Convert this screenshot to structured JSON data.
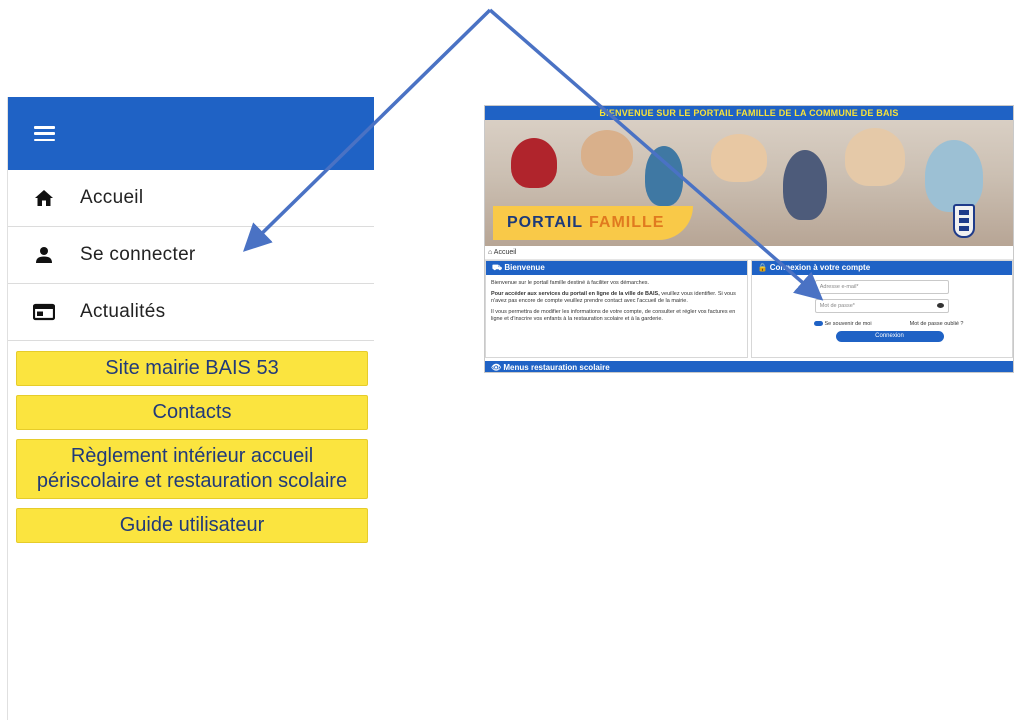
{
  "menu": {
    "items": [
      {
        "label": "Accueil",
        "icon": "home-icon"
      },
      {
        "label": "Se connecter",
        "icon": "person-icon"
      },
      {
        "label": "Actualités",
        "icon": "news-icon"
      }
    ],
    "links": [
      "Site mairie BAIS 53",
      "Contacts",
      "Règlement intérieur accueil périscolaire et restauration scolaire",
      "Guide utilisateur"
    ]
  },
  "portal": {
    "top_banner": "BIENVENUE SUR LE PORTAIL FAMILLE DE LA COMMUNE DE BAIS",
    "hero_word1": "PORTAIL",
    "hero_word2": "FAMILLE",
    "breadcrumb": "Accueil",
    "welcome": {
      "title": "Bienvenue",
      "p1": "Bienvenue sur le portail famille destiné à faciliter vos démarches.",
      "p2_bold": "Pour accéder aux services du portail en ligne de la ville de BAIS,",
      "p2_rest": "veuillez vous identifier. Si vous n'avez pas encore de compte veuillez prendre contact avec l'accueil de la mairie.",
      "p3": "Il vous permettra de modifier les informations de votre compte, de consulter et régler vos factures en ligne et d'inscrire vos enfants à la restauration scolaire et à la garderie."
    },
    "login": {
      "title": "Connexion à votre compte",
      "email_placeholder": "Adresse e-mail*",
      "password_placeholder": "Mot de passe*",
      "remember": "Se souvenir de moi",
      "forgot": "Mot de passe oublié ?",
      "button": "Connexion"
    },
    "menus_bar": "Menus restauration scolaire"
  },
  "colors": {
    "primary": "#1f62c5",
    "yellow": "#fbe43f",
    "arrow": "#4a72c4"
  }
}
